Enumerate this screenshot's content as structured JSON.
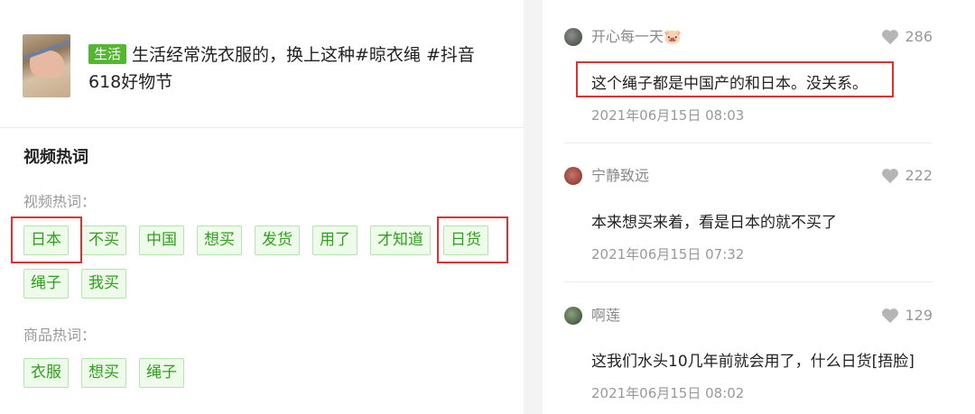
{
  "video": {
    "category": "生活",
    "title_line1": "生活经常洗衣服的，换上这种#晾衣绳 #抖音",
    "title_line2": "618好物节"
  },
  "hot_words": {
    "section_title": "视频热词",
    "video_label": "视频热词：",
    "video_row1": [
      "日本",
      "不买",
      "中国",
      "想买",
      "发货",
      "用了",
      "才知道",
      "日货"
    ],
    "video_row2": [
      "绳子",
      "我买"
    ],
    "product_label": "商品热词：",
    "product_row": [
      "衣服",
      "想买",
      "绳子"
    ]
  },
  "comments": [
    {
      "user": "开心每一天🐷",
      "likes": "286",
      "text": "这个绳子都是中国产的和日本。没关系。",
      "time": "2021年06月15日 08:03"
    },
    {
      "user": "宁静致远",
      "likes": "222",
      "text": "本来想买来着，看是日本的就不买了",
      "time": "2021年06月15日 07:32"
    },
    {
      "user": "啊莲",
      "likes": "129",
      "text": "这我们水头10几年前就会用了，什么日货[捂脸]",
      "time": "2021年06月15日 08:02"
    }
  ],
  "colors": {
    "tag_green": "#2ea01c",
    "category_green": "#54b72f",
    "highlight_red": "#e03131"
  }
}
